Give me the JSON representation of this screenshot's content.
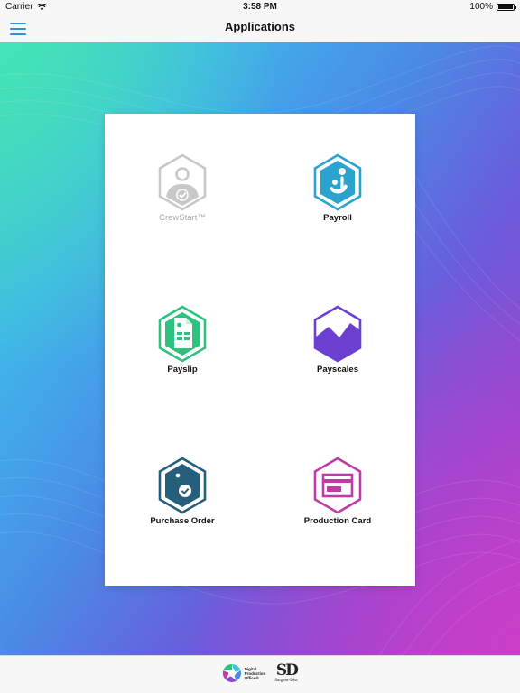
{
  "status_bar": {
    "carrier": "Carrier",
    "time": "3:58 PM",
    "battery": "100%",
    "battery_level": 1.0
  },
  "nav": {
    "title": "Applications",
    "menu_icon": "hamburger-menu-icon",
    "accent_color": "#2f8fe0"
  },
  "apps": [
    {
      "label": "CrewStart™",
      "icon": "crewstart-person-check-icon",
      "color": "#c8c8c8",
      "enabled": false
    },
    {
      "label": "Payroll",
      "icon": "payroll-face-icon",
      "color": "#2aa3cf",
      "enabled": true
    },
    {
      "label": "Payslip",
      "icon": "payslip-document-icon",
      "color": "#2ec27e",
      "enabled": true
    },
    {
      "label": "Payscales",
      "icon": "payscales-chart-icon",
      "color": "#6b3fcf",
      "enabled": true
    },
    {
      "label": "Purchase Order",
      "icon": "purchase-order-tag-check-icon",
      "color": "#255f7c",
      "enabled": true
    },
    {
      "label": "Production Card",
      "icon": "production-card-icon",
      "color": "#c23aa6",
      "enabled": true
    }
  ],
  "footer": {
    "dpo_lines": [
      "Digital",
      "Production",
      "Office®"
    ],
    "sd_mark": "SD",
    "sd_name": "Sargent-Disc"
  }
}
